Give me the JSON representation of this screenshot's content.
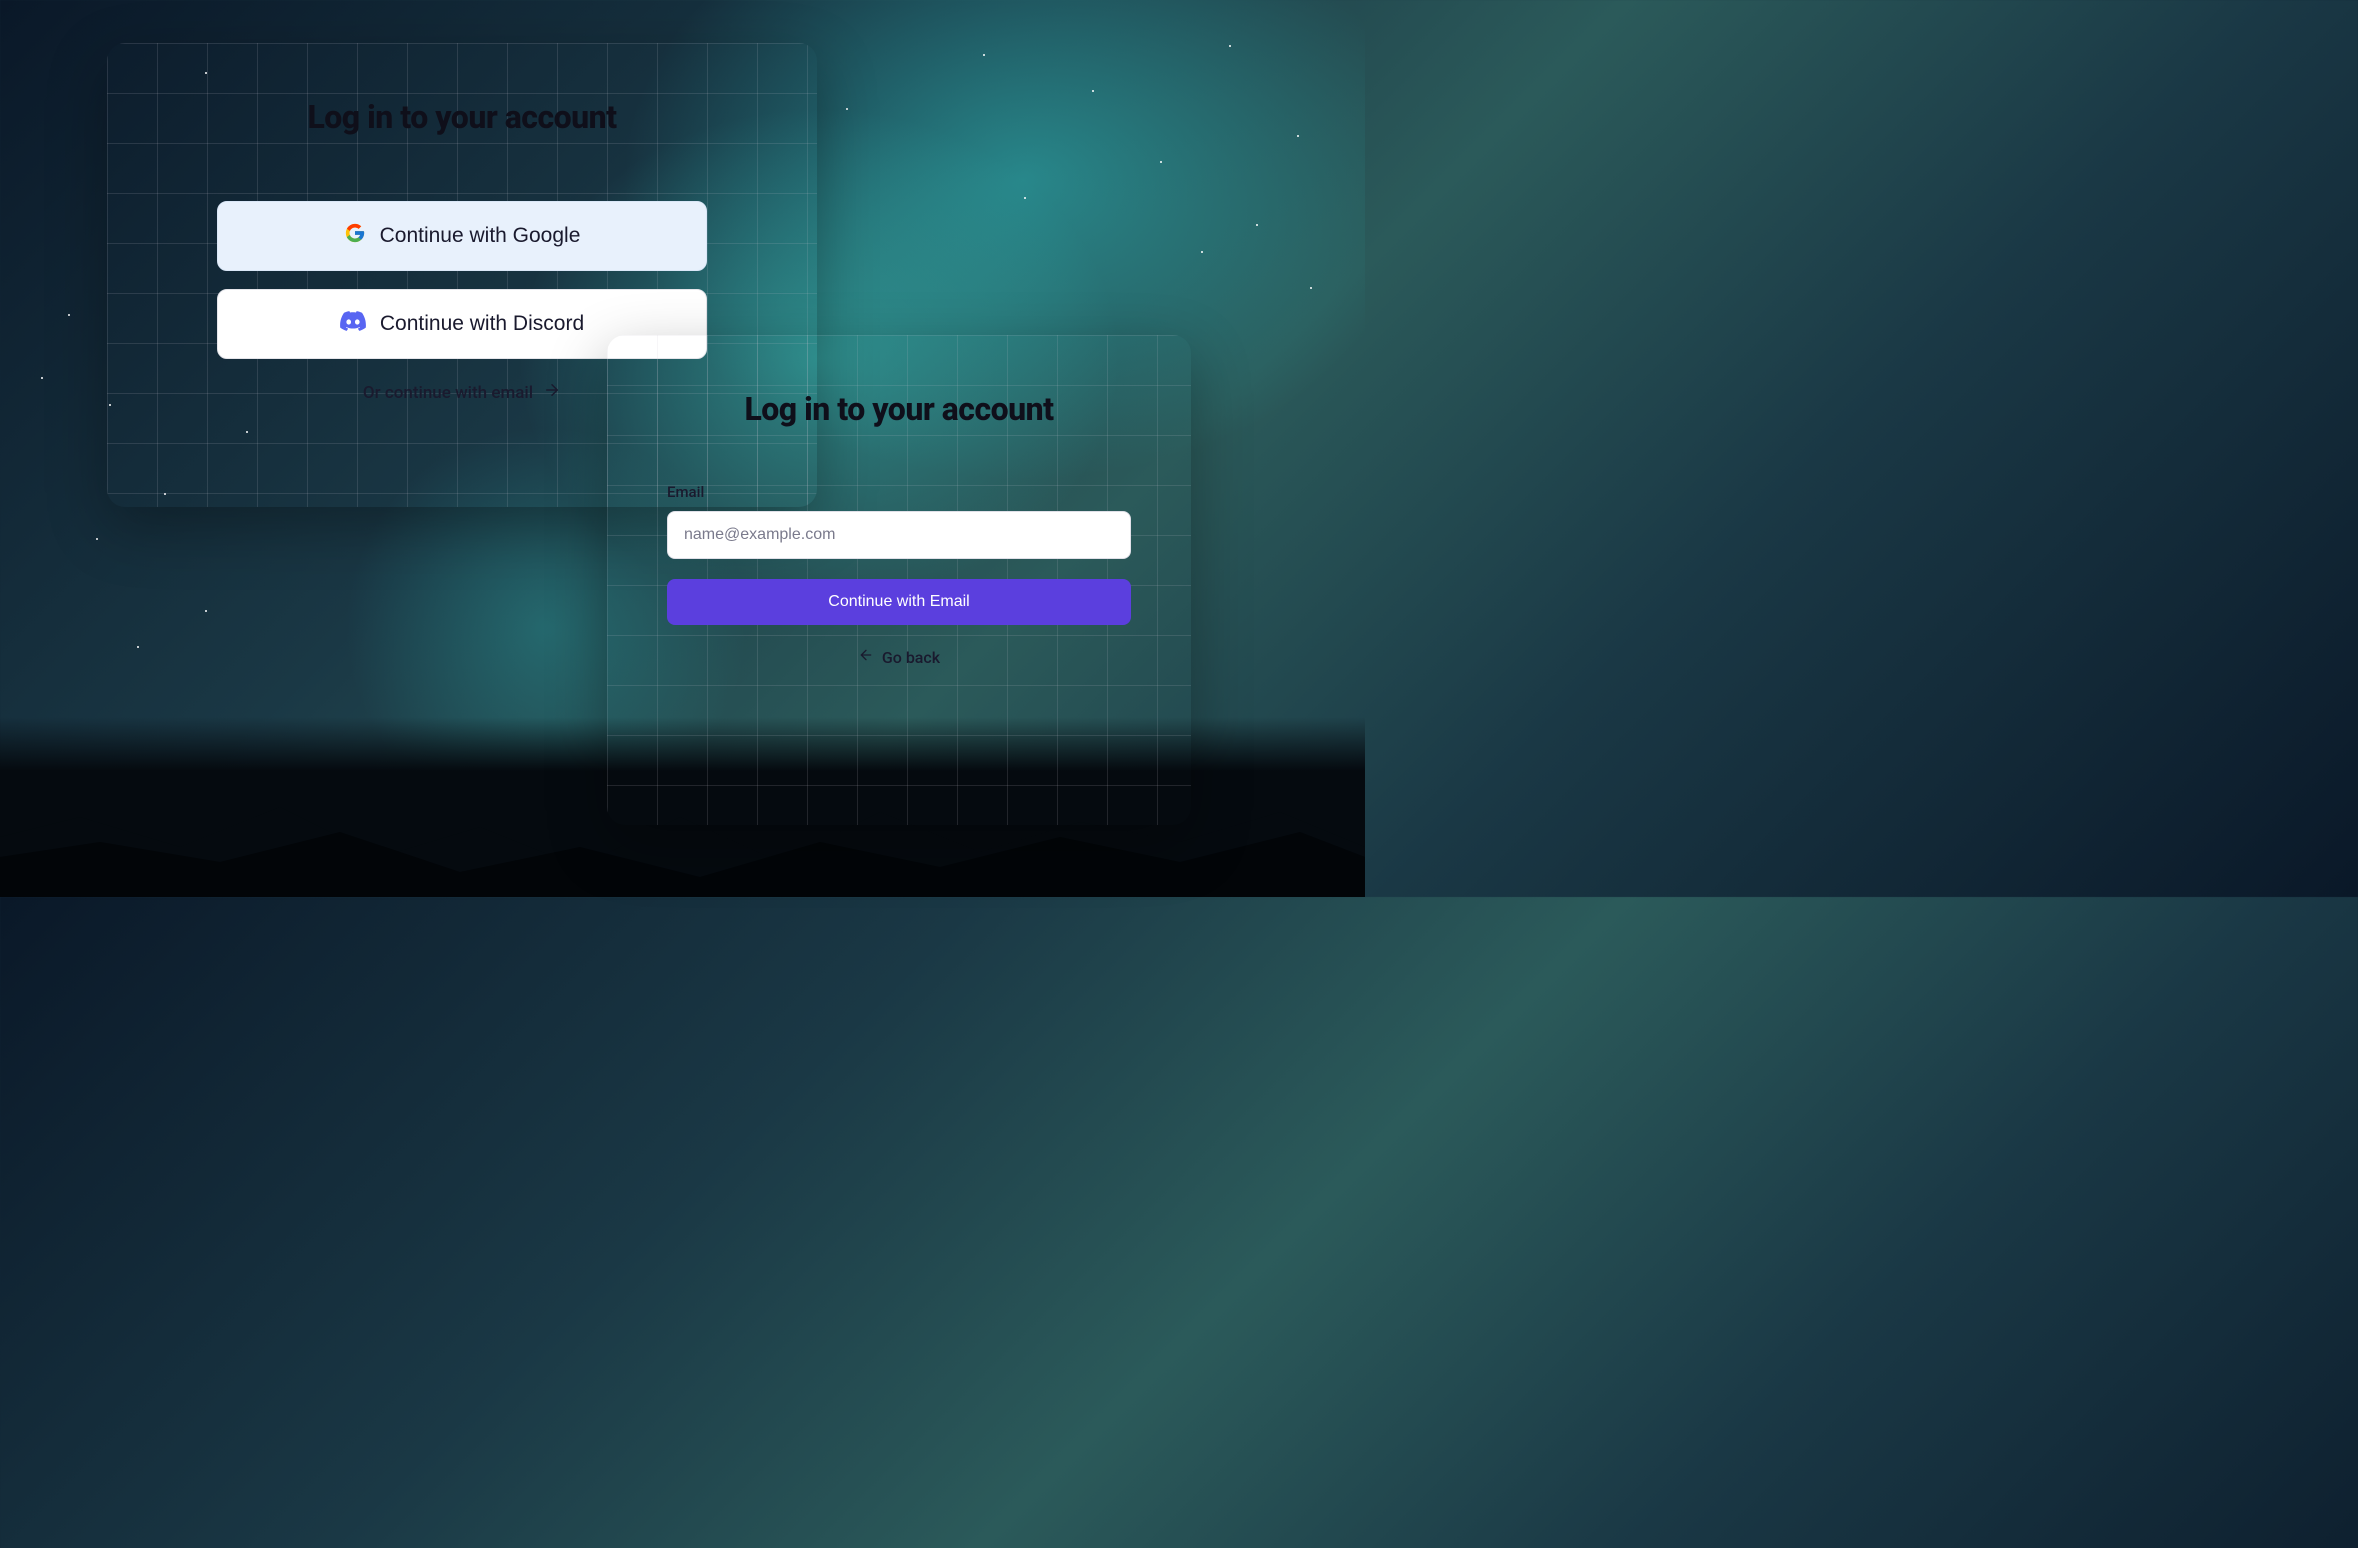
{
  "card1": {
    "title": "Log in to your account",
    "google_label": "Continue with Google",
    "discord_label": "Continue with Discord",
    "email_option_label": "Or continue with email"
  },
  "card2": {
    "title": "Log in to your account",
    "email_label": "Email",
    "email_placeholder": "name@example.com",
    "continue_button_label": "Continue with Email",
    "back_label": "Go back"
  },
  "colors": {
    "google_bg": "#e8f1fc",
    "discord_brand": "#5865F2",
    "primary_button": "#5b3fde"
  }
}
